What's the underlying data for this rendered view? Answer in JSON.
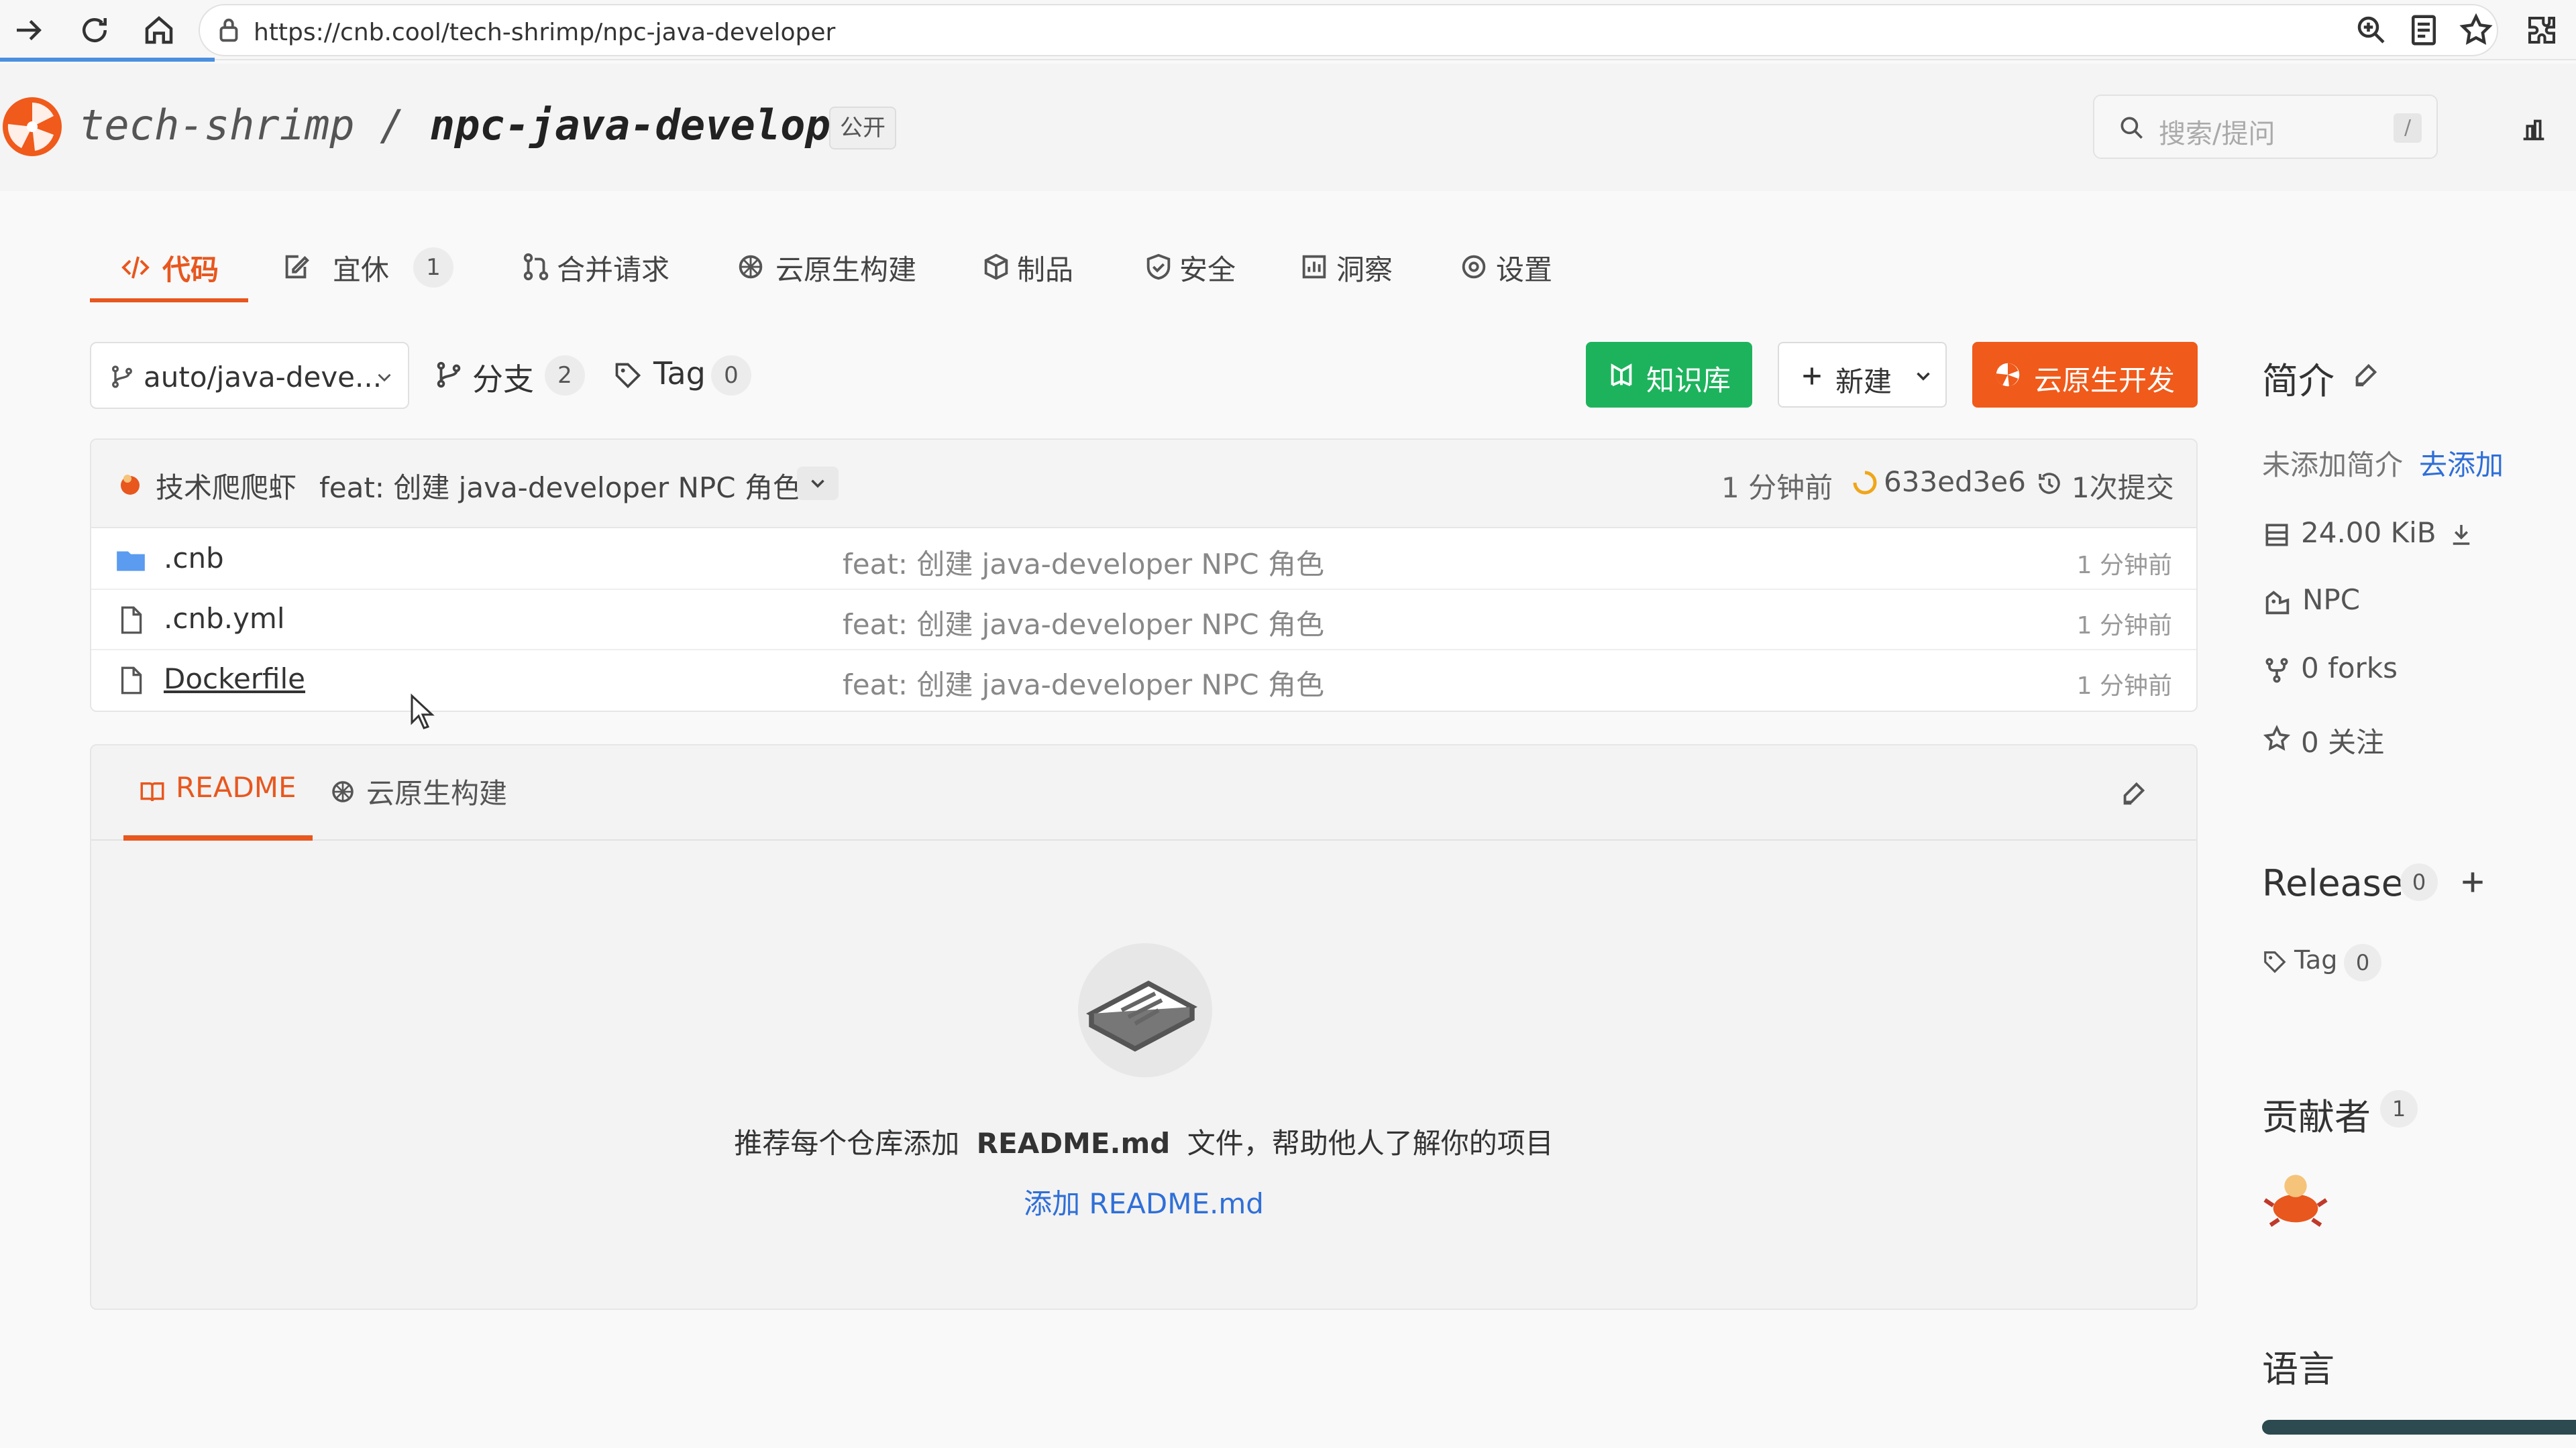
{
  "browser": {
    "url": "https://cnb.cool/tech-shrimp/npc-java-developer"
  },
  "repo": {
    "owner": "tech-shrimp",
    "separator": "/",
    "name": "npc-java-developer",
    "visibility": "公开"
  },
  "search": {
    "placeholder": "搜索/提问",
    "shortcut": "/"
  },
  "tabs": [
    {
      "label": "代码",
      "icon": "code-icon"
    },
    {
      "label": "宜休",
      "icon": "edit-icon",
      "count": "1"
    },
    {
      "label": "合并请求",
      "icon": "merge-icon"
    },
    {
      "label": "云原生构建",
      "icon": "build-icon"
    },
    {
      "label": "制品",
      "icon": "package-icon"
    },
    {
      "label": "安全",
      "icon": "shield-icon"
    },
    {
      "label": "洞察",
      "icon": "chart-icon"
    },
    {
      "label": "设置",
      "icon": "gear-icon"
    }
  ],
  "toolbar": {
    "branch": "auto/java-deve...",
    "branches_label": "分支",
    "branches_count": "2",
    "tags_label": "Tag",
    "tags_count": "0",
    "knowledge_label": "知识库",
    "new_label": "新建",
    "cloud_dev_label": "云原生开发"
  },
  "commit": {
    "author": "技术爬爬虾",
    "message": "feat: 创建 java-developer NPC 角色",
    "time": "1 分钟前",
    "hash": "633ed3e6",
    "commits": "1次提交"
  },
  "files": [
    {
      "name": ".cnb",
      "type": "folder",
      "message": "feat: 创建 java-developer NPC 角色",
      "time": "1 分钟前"
    },
    {
      "name": ".cnb.yml",
      "type": "file",
      "message": "feat: 创建 java-developer NPC 角色",
      "time": "1 分钟前"
    },
    {
      "name": "Dockerfile",
      "type": "file",
      "message": "feat: 创建 java-developer NPC 角色",
      "time": "1 分钟前"
    }
  ],
  "readme": {
    "tab_readme": "README",
    "tab_build": "云原生构建",
    "hint_prefix": "推荐每个仓库添加",
    "hint_file": "README.md",
    "hint_suffix": "文件，帮助他人了解你的项目",
    "add_link": "添加 README.md"
  },
  "sidebar": {
    "intro_title": "简介",
    "intro_empty": "未添加简介",
    "intro_add": "去添加",
    "size": "24.00 KiB",
    "npc": "NPC",
    "forks": "0 forks",
    "watchers": "0 关注",
    "release_title": "Release",
    "release_count": "0",
    "tag_label": "Tag",
    "tag_count": "0",
    "contributors_title": "贡献者",
    "contributors_count": "1",
    "language_title": "语言"
  },
  "colors": {
    "accent": "#e8571e",
    "green": "#1db35c",
    "orange": "#f05a1a",
    "link": "#2f6fd8"
  }
}
